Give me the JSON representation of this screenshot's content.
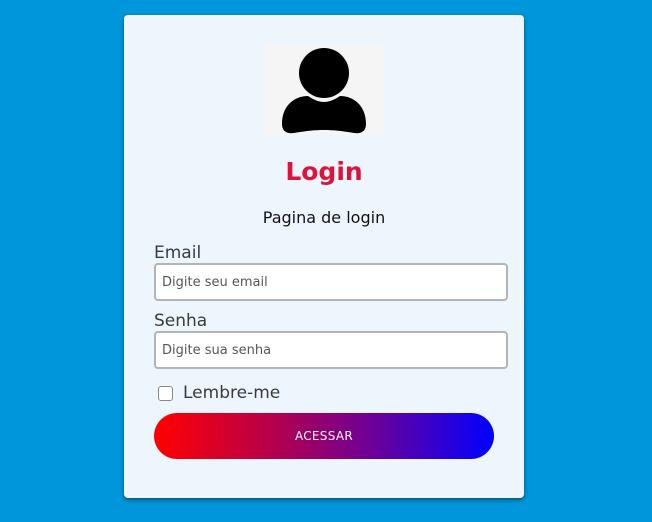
{
  "login": {
    "avatar_icon": "user-icon",
    "title": "Login",
    "subtitle": "Pagina de login",
    "email_label": "Email",
    "email_placeholder": "Digite seu email",
    "email_value": "",
    "password_label": "Senha",
    "password_placeholder": "Digite sua senha",
    "password_value": "",
    "remember_label": "Lembre-me",
    "remember_checked": false,
    "submit_label": "ACESSAR"
  },
  "colors": {
    "background": "#0096db",
    "card": "#eef6fd",
    "title": "#dc143c",
    "button_gradient_start": "#ff0000",
    "button_gradient_end": "#0000ff"
  }
}
